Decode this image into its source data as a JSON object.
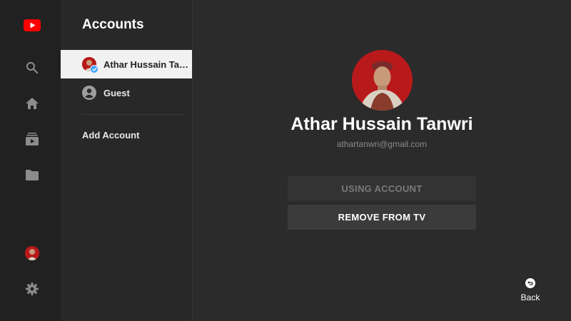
{
  "rail": {
    "icons": [
      "youtube-logo",
      "search-icon",
      "home-icon",
      "subscriptions-icon",
      "library-icon",
      "account-avatar",
      "settings-icon"
    ],
    "brand_color": "#ff0000"
  },
  "panel": {
    "title": "Accounts",
    "accounts": [
      {
        "label": "Athar Hussain Tan...",
        "selected": true
      },
      {
        "label": "Guest",
        "selected": false
      }
    ],
    "add_account_label": "Add Account"
  },
  "profile": {
    "name": "Athar Hussain Tanwri",
    "email": "athartanwri@gmail.com",
    "avatar_color": "#b8191a"
  },
  "actions": {
    "using_label": "USING ACCOUNT",
    "remove_label": "REMOVE FROM TV"
  },
  "footer": {
    "back_label": "Back"
  },
  "colors": {
    "background": "#2b2b2b",
    "rail": "#212121",
    "selected_item": "#f1f1f1",
    "check_badge": "#3ea6ff"
  }
}
